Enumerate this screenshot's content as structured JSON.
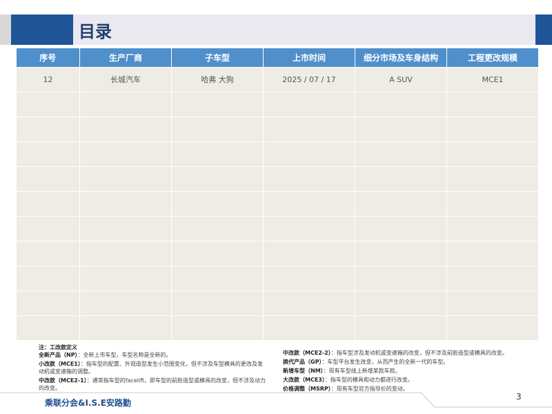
{
  "header": {
    "title": "目录"
  },
  "table": {
    "columns": [
      "序号",
      "生产厂商",
      "子车型",
      "上市时间",
      "细分市场及车身结构",
      "工程更改规模"
    ],
    "rows": [
      [
        "12",
        "长城汽车",
        "哈弗 大狗",
        "2025 / 07 / 17",
        "A SUV",
        "MCE1"
      ]
    ],
    "empty_rows": 10
  },
  "notes": {
    "heading": "注：工改款定义",
    "left": [
      {
        "term": "全新产品（NP）",
        "desc": "：全新上市车型，车型名称是全新的。"
      },
      {
        "term": "小改款（MCE1）",
        "desc": "：指车型的配置、外观造型发生小范围变化，但不涉及车型模具的更改及发动机或变速箱的调整。"
      },
      {
        "term": "中改款（MCE2-1）",
        "desc": "：通常指车型的facelift，即车型的前脸造型或模具的改变，但不涉及动力的改变。"
      }
    ],
    "right": [
      {
        "term": "中改款（MCE2-2）",
        "desc": "：指车型涉及发动机或变速箱的改变，但不涉及前脸造型或模具的改变。"
      },
      {
        "term": "换代产品（GP）",
        "desc": "：车型平台发生改变，从而产生的全新一代的车型。"
      },
      {
        "term": "新增车型（NM）",
        "desc": "：现有车型线上新增某款车款。"
      },
      {
        "term": "大改款（MCE3）",
        "desc": "：指车型的模具和动力都进行改变。"
      },
      {
        "term": "价格调整（MSRP）",
        "desc": "：现有车型官方指导价的变动。"
      }
    ]
  },
  "footer": {
    "logo": "乘联分会&I.S.E安路勤",
    "page": "3"
  }
}
